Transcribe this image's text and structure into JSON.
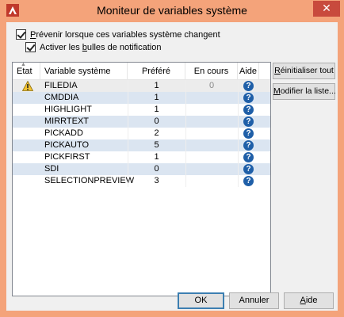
{
  "window": {
    "title": "Moniteur de variables système",
    "close_glyph": "✕",
    "accent_color": "#f4a37a",
    "close_color": "#c84a3d"
  },
  "options": {
    "notify_checkbox": {
      "label_pre": "",
      "label_u": "P",
      "label_post": "révenir lorsque ces variables système changent",
      "checked": true
    },
    "balloon_checkbox": {
      "label_pre": "Activer les ",
      "label_u": "b",
      "label_post": "ulles de notification",
      "checked": true
    }
  },
  "table": {
    "columns": {
      "state": "Etat",
      "variable": "Variable système",
      "preferred": "Préféré",
      "current": "En cours",
      "help": "Aide"
    },
    "rows": [
      {
        "state_icon": "warning-icon",
        "variable": "FILEDIA",
        "preferred": "1",
        "current": "0"
      },
      {
        "state_icon": "",
        "variable": "CMDDIA",
        "preferred": "1",
        "current": ""
      },
      {
        "state_icon": "",
        "variable": "HIGHLIGHT",
        "preferred": "1",
        "current": ""
      },
      {
        "state_icon": "",
        "variable": "MIRRTEXT",
        "preferred": "0",
        "current": ""
      },
      {
        "state_icon": "",
        "variable": "PICKADD",
        "preferred": "2",
        "current": ""
      },
      {
        "state_icon": "",
        "variable": "PICKAUTO",
        "preferred": "5",
        "current": ""
      },
      {
        "state_icon": "",
        "variable": "PICKFIRST",
        "preferred": "1",
        "current": ""
      },
      {
        "state_icon": "",
        "variable": "SDI",
        "preferred": "0",
        "current": ""
      },
      {
        "state_icon": "",
        "variable": "SELECTIONPREVIEW",
        "preferred": "3",
        "current": ""
      }
    ],
    "help_glyph": "?",
    "help_icon_color": "#1f5fa8",
    "alt_row_color": "#dbe5f1"
  },
  "side_buttons": {
    "reset_all": {
      "u": "R",
      "rest": "éinitialiser tout"
    },
    "edit_list": {
      "u": "M",
      "rest": "odifier la liste..."
    }
  },
  "footer": {
    "ok": "OK",
    "cancel": "Annuler",
    "help": {
      "u": "A",
      "rest": "ide"
    }
  }
}
